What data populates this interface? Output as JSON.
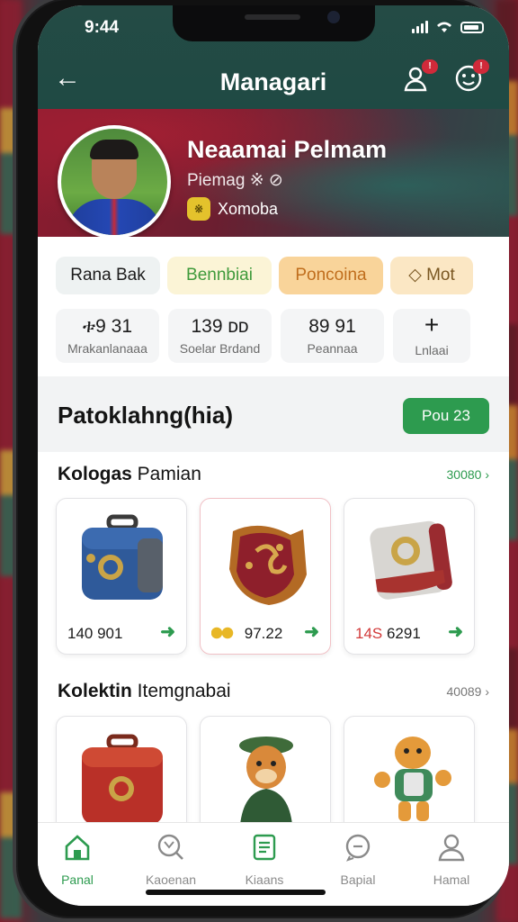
{
  "status": {
    "time": "9:44"
  },
  "header": {
    "title": "Managari",
    "back_label": "←",
    "notify_badge": "!",
    "profile_badge": "!"
  },
  "profile": {
    "name": "Neaamai Pelmam",
    "subtitle": "Piemag ※ ⊘",
    "coin_label": "Xomoba",
    "coin_glyph": "※"
  },
  "chips": [
    "Rana Bak",
    "Bennbiai",
    "Poncoina",
    "◇ Mot"
  ],
  "stats": [
    {
      "value": "ቱ9 31",
      "label": "Mrakanlanaaa"
    },
    {
      "value": "139 ᴅᴅ",
      "label": "Soelar Brdand"
    },
    {
      "value": "89 91",
      "label": "Peannaa"
    },
    {
      "value": "+",
      "label": "Lnlaai"
    }
  ],
  "section": {
    "title": "Patoklahng(hia)",
    "button": "Pou 23"
  },
  "row1": {
    "title_bold": "Kologas",
    "title_rest": " Pamian",
    "link": "30080 ›",
    "items": [
      {
        "name": "blue-backpack",
        "price_prefix": "",
        "price": "140 901"
      },
      {
        "name": "crest-shield",
        "price_prefix": "coins",
        "price": "97.22"
      },
      {
        "name": "grey-bag",
        "price_prefix": "14S",
        "price": " 6291"
      }
    ]
  },
  "row2": {
    "title_bold": "Kolektin",
    "title_rest": " Itemgnabai",
    "link": "40089 ›",
    "items": [
      {
        "name": "red-backpack"
      },
      {
        "name": "fox-figure"
      },
      {
        "name": "tiger-mascot"
      }
    ]
  },
  "tabs": [
    {
      "label": "Panal",
      "icon": "home-icon",
      "active": true
    },
    {
      "label": "Kaoenan",
      "icon": "search-icon",
      "active": false
    },
    {
      "label": "Kiaans",
      "icon": "list-icon",
      "active": false
    },
    {
      "label": "Bapial",
      "icon": "chat-icon",
      "active": false
    },
    {
      "label": "Hamal",
      "icon": "user-icon",
      "active": false
    }
  ],
  "colors": {
    "accent": "#2d9b4f",
    "header": "#244b45",
    "hero": "#8a1c2f"
  }
}
